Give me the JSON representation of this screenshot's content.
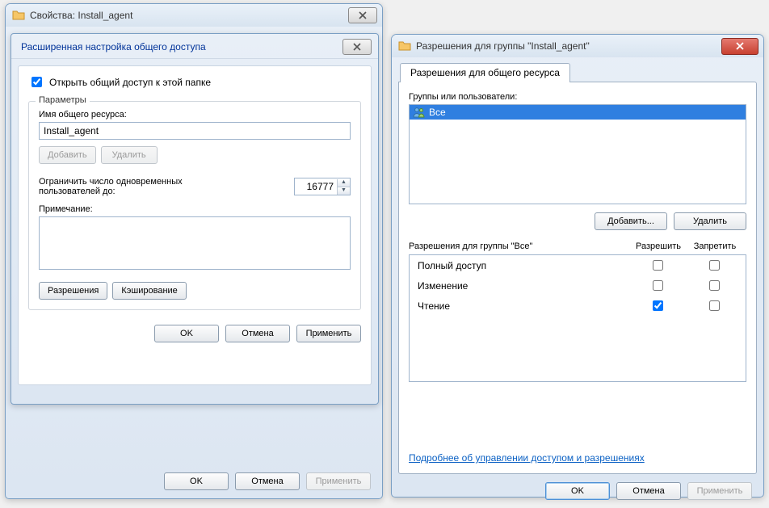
{
  "window1": {
    "title": "Свойства: Install_agent",
    "sharing": {
      "subtitle": "Расширенная настройка общего доступа",
      "share_checkbox_label": "Открыть общий доступ к этой папке",
      "share_checked": true,
      "params_legend": "Параметры",
      "share_name_label": "Имя общего ресурса:",
      "share_name_value": "Install_agent",
      "add_btn": "Добавить",
      "remove_btn": "Удалить",
      "limit_label_line1": "Ограничить число одновременных",
      "limit_label_line2": "пользователей до:",
      "limit_value": "16777",
      "note_label": "Примечание:",
      "permissions_btn": "Разрешения",
      "caching_btn": "Кэширование",
      "ok": "OK",
      "cancel": "Отмена",
      "apply": "Применить"
    },
    "bottom": {
      "ok": "OK",
      "cancel": "Отмена",
      "apply": "Применить"
    }
  },
  "window3": {
    "title": "Разрешения для группы \"Install_agent\"",
    "tab_label": "Разрешения для общего ресурса",
    "groups_label": "Группы или пользователи:",
    "user_item": "Все",
    "add_btn": "Добавить...",
    "remove_btn": "Удалить",
    "perm_for_label": "Разрешения для группы \"Все\"",
    "col_allow": "Разрешить",
    "col_deny": "Запретить",
    "rows": [
      {
        "name": "Полный доступ",
        "allow": false,
        "deny": false
      },
      {
        "name": "Изменение",
        "allow": false,
        "deny": false
      },
      {
        "name": "Чтение",
        "allow": true,
        "deny": false
      }
    ],
    "learn_link": "Подробнее об управлении доступом и разрешениях",
    "ok": "OK",
    "cancel": "Отмена",
    "apply": "Применить"
  }
}
